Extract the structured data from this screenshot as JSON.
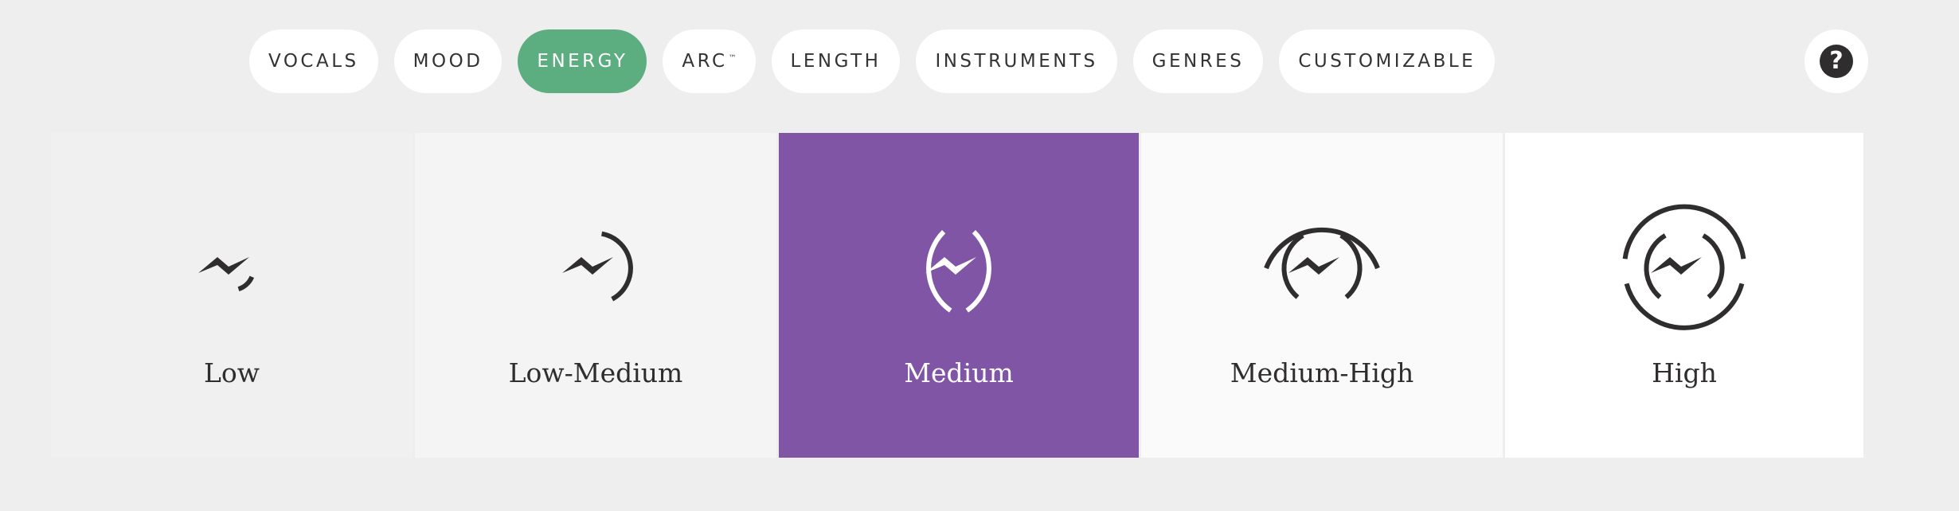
{
  "tabs": [
    {
      "label": "VOCALS",
      "active": false
    },
    {
      "label": "MOOD",
      "active": false
    },
    {
      "label": "ENERGY",
      "active": true
    },
    {
      "label": "ARC",
      "sup": "™",
      "active": false
    },
    {
      "label": "LENGTH",
      "active": false
    },
    {
      "label": "INSTRUMENTS",
      "active": false
    },
    {
      "label": "GENRES",
      "active": false
    },
    {
      "label": "CUSTOMIZABLE",
      "active": false
    }
  ],
  "help": {
    "glyph": "?",
    "icon": "question-circle-icon"
  },
  "energy_levels": [
    {
      "label": "Low",
      "icon": "energy-low-icon",
      "selected": false
    },
    {
      "label": "Low-Medium",
      "icon": "energy-low-medium-icon",
      "selected": false
    },
    {
      "label": "Medium",
      "icon": "energy-medium-icon",
      "selected": true
    },
    {
      "label": "Medium-High",
      "icon": "energy-medium-high-icon",
      "selected": false
    },
    {
      "label": "High",
      "icon": "energy-high-icon",
      "selected": false
    }
  ],
  "colors": {
    "page_background": "#eeeeee",
    "tab_background": "#ffffff",
    "tab_active": "#5cae81",
    "card_selected": "#8055a6",
    "card_shades": [
      "#f0f0f0",
      "#f4f4f4",
      "#8055a6",
      "#fafafa",
      "#ffffff"
    ],
    "icon_dark": "#2f2d2d",
    "icon_light": "#ffffff"
  }
}
